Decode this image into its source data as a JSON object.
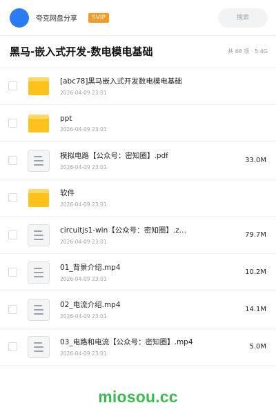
{
  "header": {
    "brand": "夸克网盘分享",
    "badge": "SVIP",
    "search_placeholder": "搜索"
  },
  "share": {
    "title": "黑马-嵌入式开发-数电模电基础",
    "meta": "共 68 项 · 5.4G"
  },
  "files": [
    {
      "type": "folder",
      "name": "[abc78]黑马嵌入式开发数电模电基础",
      "date": "2026-04-09 23:01",
      "size": ""
    },
    {
      "type": "folder",
      "name": "ppt",
      "date": "2026-04-09 23:01",
      "size": ""
    },
    {
      "type": "file",
      "name": "模拟电路【公众号：密知圈】.pdf",
      "date": "2026-04-09 23:01",
      "size": "33.0M"
    },
    {
      "type": "folder",
      "name": "软件",
      "date": "2026-04-09 23:01",
      "size": ""
    },
    {
      "type": "file",
      "name": "circuitjs1-win【公众号：密知圈】.z…",
      "date": "2026-04-09 23:01",
      "size": "79.7M"
    },
    {
      "type": "file",
      "name": "01_背景介绍.mp4",
      "date": "2026-04-09 23:01",
      "size": "10.2M"
    },
    {
      "type": "file",
      "name": "02_电流介绍.mp4",
      "date": "2026-04-09 23:01",
      "size": "14.1M"
    },
    {
      "type": "file",
      "name": "03_电路和电流【公众号：密知圈】.mp4",
      "date": "2026-04-09 23:01",
      "size": "5.0M"
    }
  ],
  "watermark": "miosou.cc",
  "colors": {
    "accent": "#2b7bf3",
    "svip": "#f59a23",
    "folder": "#ffc21a",
    "watermark": "#3dbb4f"
  }
}
